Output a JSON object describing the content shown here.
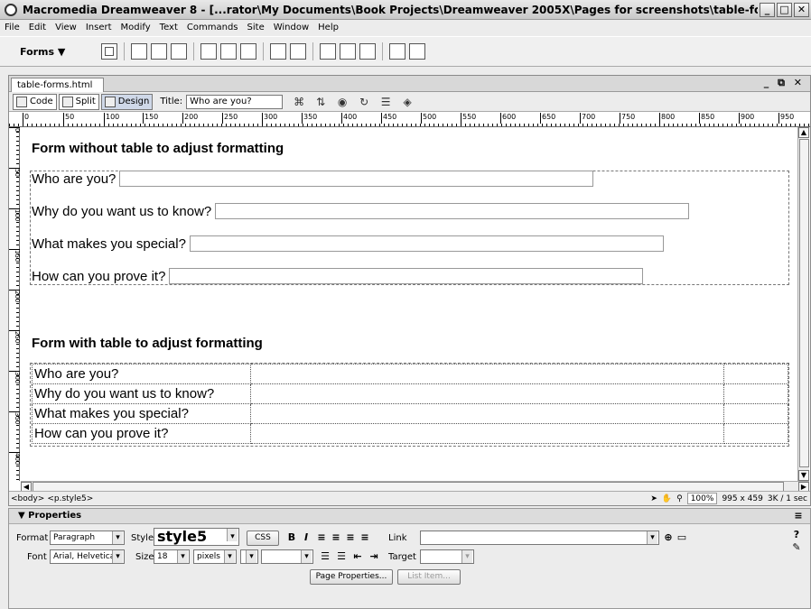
{
  "window": {
    "title": "Macromedia Dreamweaver 8 - [...rator\\My Documents\\Book Projects\\Dreamweaver 2005X\\Pages for screenshots\\table-forms.html (XHTML)]"
  },
  "menu": [
    "File",
    "Edit",
    "View",
    "Insert",
    "Modify",
    "Text",
    "Commands",
    "Site",
    "Window",
    "Help"
  ],
  "insert_bar": {
    "category": "Forms ▼"
  },
  "document": {
    "tab": "table-forms.html",
    "view_buttons": {
      "code": "Code",
      "split": "Split",
      "design": "Design"
    },
    "title_label": "Title:",
    "title_value": "Who are you?",
    "ruler_ticks": [
      "0",
      "50",
      "100",
      "150",
      "200",
      "250",
      "300",
      "350",
      "400",
      "450",
      "500",
      "550",
      "600",
      "650",
      "700",
      "750",
      "800",
      "850",
      "900",
      "950"
    ],
    "vruler_ticks": [
      "0",
      "50",
      "100",
      "150",
      "200",
      "250",
      "300",
      "350",
      "400"
    ]
  },
  "content": {
    "heading1": "Form without table to adjust formatting",
    "form1_labels": [
      "Who are you?",
      "Why do you want us to know?",
      "What makes you special?",
      "How can you prove it?"
    ],
    "heading2": "Form with table to adjust formatting",
    "form2_labels": [
      "Who are you?",
      "Why do you want us to know?",
      "What makes you special?",
      "How can you prove it?"
    ]
  },
  "status": {
    "tag_body": "<body>",
    "tag_p": "<p.style5>",
    "zoom": "100%",
    "size": "995 x 459",
    "download": "3K / 1 sec"
  },
  "properties": {
    "header": "▼ Properties",
    "format_label": "Format",
    "format_value": "Paragraph",
    "style_label": "Style",
    "style_value": "style5",
    "css_button": "CSS",
    "link_label": "Link",
    "font_label": "Font",
    "font_value": "Arial, Helvetica",
    "size_label": "Size",
    "size_value": "18",
    "unit_value": "pixels",
    "target_label": "Target",
    "page_props_button": "Page Properties...",
    "list_item_button": "List Item..."
  }
}
